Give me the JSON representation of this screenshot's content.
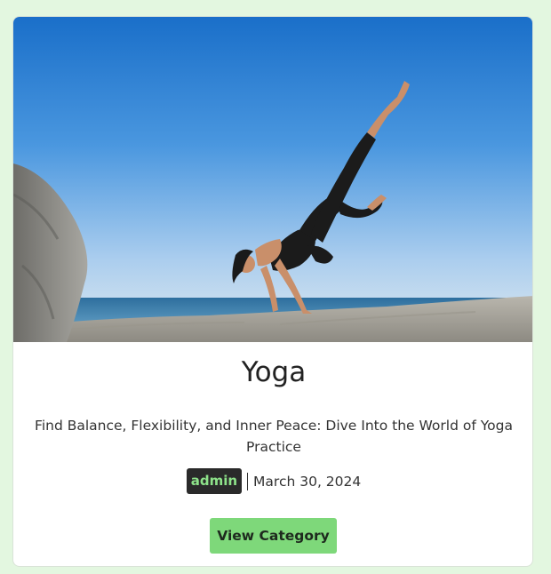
{
  "post": {
    "title": "Yoga",
    "excerpt": "Find Balance, Flexibility, and Inner Peace: Dive Into the World of Yoga Practice",
    "author": "admin",
    "date": "March 30, 2024",
    "button_label": "View Category"
  },
  "colors": {
    "page_background": "#e3f7e0",
    "button_background": "#7ed87a",
    "badge_background": "#2a2a2a",
    "badge_text": "#8ee38a"
  }
}
